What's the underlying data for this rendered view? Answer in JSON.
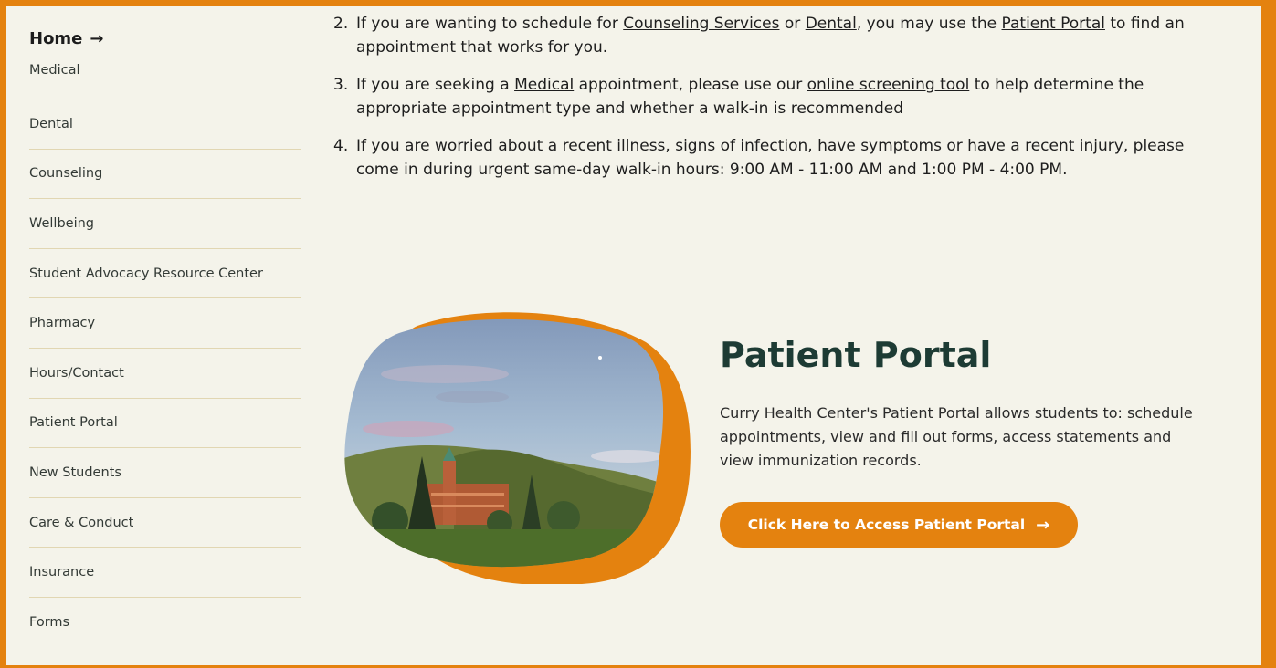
{
  "sidebar": {
    "home_label": "Home",
    "home_arrow": "→",
    "items": [
      {
        "label": "Medical"
      },
      {
        "label": "Dental"
      },
      {
        "label": "Counseling"
      },
      {
        "label": "Wellbeing"
      },
      {
        "label": "Student Advocacy Resource Center"
      },
      {
        "label": "Pharmacy"
      },
      {
        "label": "Hours/Contact"
      },
      {
        "label": "Patient Portal"
      },
      {
        "label": "New Students"
      },
      {
        "label": "Care & Conduct"
      },
      {
        "label": "Insurance"
      },
      {
        "label": "Forms"
      }
    ]
  },
  "steps": {
    "s2": {
      "num": "2.",
      "t1": "If you are wanting to schedule for ",
      "link1": "Counseling Services",
      "t2": " or ",
      "link2": "Dental",
      "t3": ", you may use the ",
      "link3": "Patient Portal",
      "t4": " to find an appointment that works for you."
    },
    "s3": {
      "num": "3.",
      "t1": "If you are seeking a ",
      "link1": "Medical",
      "t2": " appointment, please use our ",
      "link2": "online screening tool",
      "t3": " to help determine the appropriate appointment type and whether a walk-in is recommended"
    },
    "s4": {
      "num": "4.",
      "t1": "If you are worried about a recent illness, signs of infection, have symptoms or have a recent injury, please come in during urgent same-day walk-in hours: 9:00 AM - 11:00 AM and 1:00 PM - 4:00 PM."
    }
  },
  "portal": {
    "title": "Patient Portal",
    "description": "Curry Health Center's Patient Portal allows students to: schedule appointments, view and fill out forms, access statements and view immunization records.",
    "button_label": "Click Here to Access Patient Portal",
    "button_arrow": "→"
  },
  "colors": {
    "accent": "#e4820f",
    "background": "#f4f3ea",
    "heading": "#1d3b34",
    "divider": "#e1d6b2"
  }
}
